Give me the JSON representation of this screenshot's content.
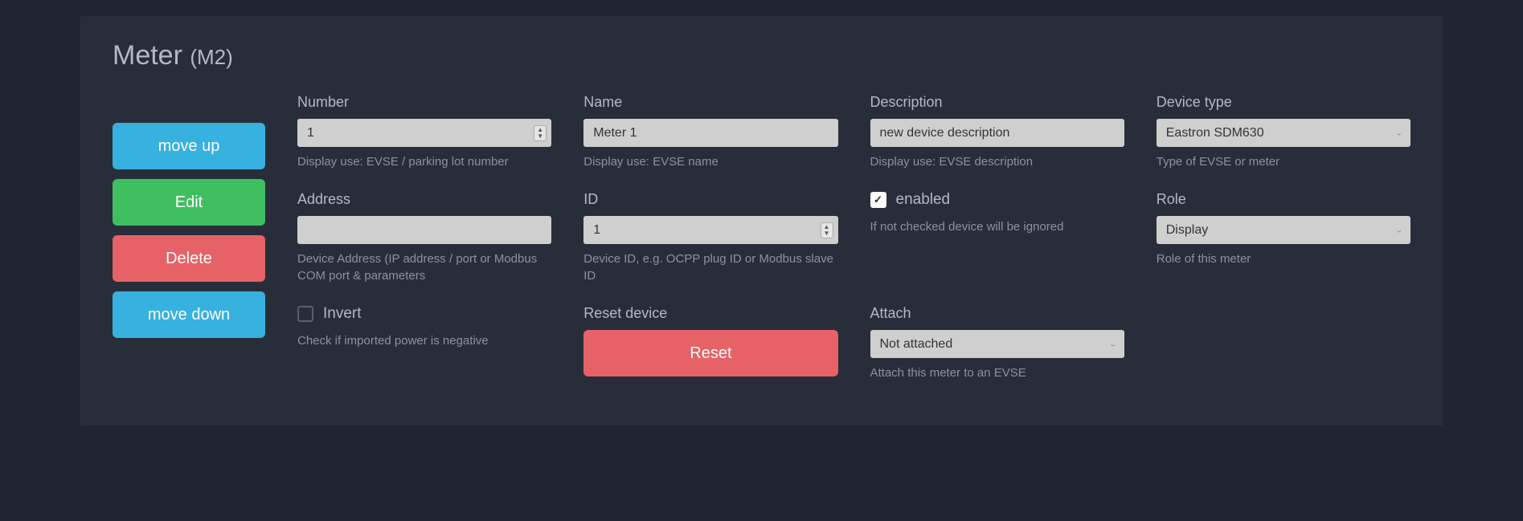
{
  "title": {
    "main": "Meter ",
    "sub": "(M2)"
  },
  "sidebar": {
    "move_up": "move up",
    "edit": "Edit",
    "delete": "Delete",
    "move_down": "move down"
  },
  "fields": {
    "number": {
      "label": "Number",
      "value": "1",
      "hint": "Display use: EVSE / parking lot number"
    },
    "name": {
      "label": "Name",
      "value": "Meter 1",
      "hint": "Display use: EVSE name"
    },
    "description": {
      "label": "Description",
      "value": "new device description",
      "hint": "Display use: EVSE description"
    },
    "device_type": {
      "label": "Device type",
      "value": "Eastron SDM630",
      "hint": "Type of EVSE or meter"
    },
    "address": {
      "label": "Address",
      "value": "",
      "hint": "Device Address (IP address / port or Modbus COM port & parameters"
    },
    "id": {
      "label": "ID",
      "value": "1",
      "hint": "Device ID, e.g. OCPP plug ID or Modbus slave ID"
    },
    "enabled": {
      "label": "enabled",
      "checked": true,
      "hint": "If not checked device will be ignored"
    },
    "role": {
      "label": "Role",
      "value": "Display",
      "hint": "Role of this meter"
    },
    "invert": {
      "label": "Invert",
      "checked": false,
      "hint": "Check if imported power is negative"
    },
    "reset": {
      "label": "Reset device",
      "button": "Reset"
    },
    "attach": {
      "label": "Attach",
      "value": "Not attached",
      "hint": "Attach this meter to an EVSE"
    }
  }
}
